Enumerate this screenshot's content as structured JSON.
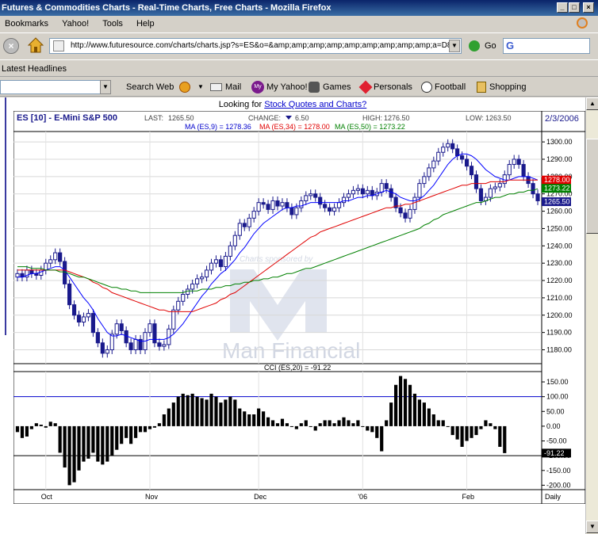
{
  "window": {
    "title": "Futures & Commodities Charts - Real-Time Charts, Free Charts - Mozilla Firefox"
  },
  "menu": {
    "items": [
      "Bookmarks",
      "Yahoo!",
      "Tools",
      "Help"
    ]
  },
  "nav": {
    "url": "http://www.futuresource.com/charts/charts.jsp?s=ES&o=&amp;amp;amp;amp;amp;amp;amp;amp;amp;a=D8",
    "go_label": "Go"
  },
  "bookmarks": {
    "item": "Latest Headlines"
  },
  "yahoo_toolbar": {
    "items": [
      "Search Web",
      "Mail",
      "My Yahoo!",
      "Games",
      "Personals",
      "Football",
      "Shopping"
    ]
  },
  "page": {
    "looking_prefix": "Looking for ",
    "looking_link": "Stock Quotes and Charts?"
  },
  "chart_header": {
    "symbol": "ES [10] - E-Mini S&P 500",
    "last_label": "LAST:",
    "last_value": "1265.50",
    "change_label": "CHANGE:",
    "change_value": "6.50",
    "high_label": "HIGH:",
    "high_value": "1276.50",
    "low_label": "LOW:",
    "low_value": "1263.50",
    "date": "2/3/2006"
  },
  "ma_legend": {
    "ma9": "MA (ES,9) = 1278.36",
    "ma34": "MA (ES,34) = 1278.00",
    "ma50": "MA (ES,50) = 1273.22"
  },
  "watermark": {
    "sponsor": "Charts sponsored by",
    "brand": "Man Financial"
  },
  "cci_header": "CCI (ES,20) = -91.22",
  "price_axis": {
    "ticks": [
      "1300.00",
      "1290.00",
      "1280.00",
      "1270.00",
      "1260.00",
      "1250.00",
      "1240.00",
      "1230.00",
      "1220.00",
      "1210.00",
      "1200.00",
      "1190.00",
      "1180.00"
    ],
    "tag_ma34": "1278.00",
    "tag_ma50": "1273.22",
    "tag_last": "1265.50"
  },
  "cci_axis": {
    "ticks": [
      "150.00",
      "100.00",
      "50.00",
      "0.00",
      "-50.00",
      "-100.00",
      "-150.00",
      "-200.00"
    ],
    "tag_value": "-91.22"
  },
  "x_axis": {
    "labels": [
      "Oct",
      "Nov",
      "Dec",
      "'06",
      "Feb"
    ],
    "period": "Daily"
  },
  "colors": {
    "candle": "#1a1a8c",
    "ma9": "#0000ff",
    "ma34": "#e00000",
    "ma50": "#008000",
    "cci": "#000000",
    "ref_line": "#0000cc"
  },
  "chart_data": [
    {
      "type": "candlestick",
      "title": "ES [10] - E-Mini S&P 500",
      "period": "Daily",
      "ylim": [
        1172,
        1306
      ],
      "x_labels": [
        "Oct",
        "Nov",
        "Dec",
        "'06",
        "Feb"
      ],
      "close": [
        1224,
        1222,
        1226,
        1224,
        1223,
        1226,
        1230,
        1232,
        1236,
        1231,
        1218,
        1206,
        1200,
        1196,
        1199,
        1201,
        1190,
        1184,
        1178,
        1180,
        1189,
        1195,
        1191,
        1184,
        1180,
        1186,
        1180,
        1190,
        1195,
        1184,
        1182,
        1183,
        1192,
        1203,
        1208,
        1212,
        1215,
        1218,
        1221,
        1222,
        1226,
        1230,
        1232,
        1228,
        1234,
        1240,
        1246,
        1253,
        1251,
        1256,
        1260,
        1265,
        1264,
        1261,
        1266,
        1263,
        1265,
        1262,
        1258,
        1262,
        1266,
        1269,
        1270,
        1268,
        1264,
        1262,
        1260,
        1262,
        1265,
        1268,
        1270,
        1272,
        1273,
        1270,
        1272,
        1269,
        1271,
        1276,
        1273,
        1268,
        1262,
        1259,
        1256,
        1261,
        1268,
        1276,
        1280,
        1285,
        1289,
        1294,
        1297,
        1299,
        1296,
        1292,
        1290,
        1286,
        1281,
        1273,
        1266,
        1268,
        1273,
        1274,
        1276,
        1281,
        1287,
        1290,
        1287,
        1280,
        1276,
        1270,
        1266
      ],
      "open": [
        1222,
        1224,
        1222,
        1226,
        1224,
        1223,
        1226,
        1230,
        1232,
        1236,
        1231,
        1218,
        1206,
        1200,
        1196,
        1199,
        1201,
        1190,
        1184,
        1178,
        1180,
        1189,
        1195,
        1191,
        1184,
        1180,
        1186,
        1180,
        1190,
        1195,
        1184,
        1182,
        1183,
        1192,
        1203,
        1208,
        1212,
        1215,
        1218,
        1221,
        1222,
        1226,
        1230,
        1232,
        1228,
        1234,
        1240,
        1246,
        1253,
        1251,
        1256,
        1260,
        1265,
        1264,
        1261,
        1266,
        1263,
        1265,
        1262,
        1258,
        1262,
        1266,
        1269,
        1270,
        1268,
        1264,
        1262,
        1260,
        1262,
        1265,
        1268,
        1270,
        1272,
        1273,
        1270,
        1272,
        1269,
        1271,
        1276,
        1273,
        1268,
        1262,
        1259,
        1256,
        1261,
        1268,
        1276,
        1280,
        1285,
        1289,
        1294,
        1297,
        1299,
        1296,
        1292,
        1290,
        1286,
        1281,
        1273,
        1266,
        1268,
        1273,
        1274,
        1276,
        1281,
        1287,
        1290,
        1287,
        1280,
        1276,
        1270
      ],
      "series": [
        {
          "name": "MA (ES,9)",
          "values": [
            1222,
            1222,
            1223,
            1224,
            1224,
            1225,
            1226,
            1227,
            1228,
            1228,
            1226,
            1222,
            1218,
            1214,
            1210,
            1207,
            1203,
            1198,
            1194,
            1190,
            1188,
            1188,
            1189,
            1188,
            1187,
            1186,
            1185,
            1185,
            1186,
            1186,
            1186,
            1186,
            1187,
            1189,
            1192,
            1195,
            1199,
            1203,
            1207,
            1211,
            1214,
            1218,
            1221,
            1224,
            1226,
            1229,
            1232,
            1236,
            1239,
            1243,
            1247,
            1250,
            1253,
            1255,
            1257,
            1259,
            1261,
            1262,
            1262,
            1263,
            1263,
            1264,
            1265,
            1265,
            1265,
            1265,
            1265,
            1265,
            1265,
            1266,
            1266,
            1267,
            1268,
            1268,
            1269,
            1269,
            1270,
            1271,
            1272,
            1271,
            1270,
            1268,
            1267,
            1266,
            1266,
            1267,
            1269,
            1272,
            1275,
            1279,
            1283,
            1287,
            1290,
            1292,
            1293,
            1293,
            1292,
            1290,
            1287,
            1284,
            1282,
            1280,
            1279,
            1278,
            1278,
            1279,
            1280,
            1280,
            1280,
            1279,
            1278
          ]
        },
        {
          "name": "MA (ES,34)",
          "values": [
            1226,
            1226,
            1226,
            1226,
            1226,
            1226,
            1226,
            1226,
            1226,
            1226,
            1226,
            1225,
            1224,
            1223,
            1222,
            1221,
            1219,
            1218,
            1216,
            1215,
            1213,
            1212,
            1211,
            1210,
            1209,
            1208,
            1207,
            1206,
            1205,
            1204,
            1203,
            1203,
            1202,
            1202,
            1202,
            1202,
            1202,
            1202,
            1203,
            1204,
            1205,
            1206,
            1207,
            1209,
            1210,
            1212,
            1213,
            1215,
            1217,
            1219,
            1221,
            1223,
            1225,
            1227,
            1229,
            1231,
            1233,
            1235,
            1237,
            1239,
            1241,
            1243,
            1245,
            1246,
            1248,
            1249,
            1250,
            1251,
            1252,
            1253,
            1254,
            1255,
            1256,
            1257,
            1258,
            1259,
            1260,
            1261,
            1262,
            1262,
            1263,
            1263,
            1264,
            1264,
            1265,
            1266,
            1267,
            1268,
            1269,
            1270,
            1271,
            1272,
            1273,
            1274,
            1275,
            1275,
            1276,
            1276,
            1276,
            1276,
            1277,
            1277,
            1277,
            1277,
            1278,
            1278,
            1278,
            1278,
            1278,
            1278,
            1278
          ]
        },
        {
          "name": "MA (ES,50)",
          "values": [
            1228,
            1228,
            1228,
            1227,
            1227,
            1227,
            1226,
            1226,
            1226,
            1225,
            1225,
            1224,
            1223,
            1222,
            1222,
            1221,
            1220,
            1219,
            1218,
            1217,
            1216,
            1216,
            1215,
            1215,
            1214,
            1214,
            1213,
            1213,
            1213,
            1213,
            1213,
            1213,
            1213,
            1213,
            1213,
            1213,
            1214,
            1214,
            1214,
            1215,
            1215,
            1215,
            1216,
            1216,
            1217,
            1217,
            1218,
            1218,
            1219,
            1219,
            1220,
            1220,
            1221,
            1221,
            1222,
            1222,
            1223,
            1224,
            1224,
            1225,
            1226,
            1227,
            1227,
            1228,
            1229,
            1230,
            1231,
            1232,
            1233,
            1234,
            1235,
            1236,
            1237,
            1238,
            1239,
            1240,
            1241,
            1242,
            1243,
            1244,
            1245,
            1246,
            1247,
            1248,
            1249,
            1250,
            1252,
            1253,
            1255,
            1256,
            1258,
            1259,
            1260,
            1261,
            1262,
            1263,
            1264,
            1265,
            1265,
            1266,
            1267,
            1268,
            1268,
            1269,
            1270,
            1270,
            1271,
            1271,
            1272,
            1272,
            1273
          ]
        }
      ]
    },
    {
      "type": "bar",
      "title": "CCI (ES,20) = -91.22",
      "ylim": [
        -215,
        185
      ],
      "reference_lines": [
        100,
        -100
      ],
      "values": [
        -20,
        -40,
        -35,
        -10,
        10,
        5,
        -5,
        15,
        10,
        -90,
        -140,
        -200,
        -190,
        -150,
        -120,
        -110,
        -90,
        -120,
        -130,
        -120,
        -100,
        -80,
        -60,
        -40,
        -60,
        -40,
        -20,
        -20,
        -10,
        -5,
        10,
        40,
        60,
        80,
        100,
        110,
        105,
        110,
        100,
        95,
        90,
        110,
        100,
        80,
        90,
        100,
        90,
        60,
        50,
        40,
        40,
        60,
        50,
        30,
        20,
        10,
        25,
        10,
        0,
        -10,
        10,
        20,
        0,
        -15,
        10,
        20,
        20,
        10,
        20,
        30,
        20,
        10,
        20,
        0,
        -15,
        -20,
        -40,
        -85,
        20,
        80,
        140,
        170,
        160,
        140,
        110,
        90,
        80,
        60,
        40,
        20,
        20,
        0,
        -30,
        -45,
        -70,
        -50,
        -40,
        -30,
        -10,
        20,
        10,
        -10,
        -70,
        -91.22
      ]
    }
  ]
}
